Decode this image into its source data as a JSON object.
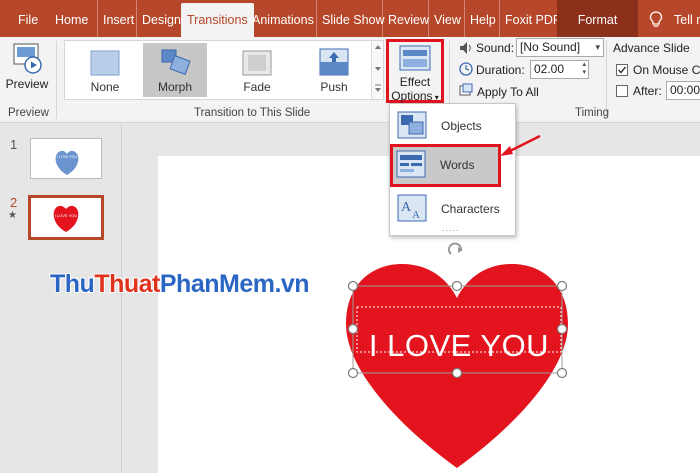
{
  "tabs": [
    {
      "label": "File"
    },
    {
      "label": "Home"
    },
    {
      "label": "Insert"
    },
    {
      "label": "Design"
    },
    {
      "label": "Transitions"
    },
    {
      "label": "Animations"
    },
    {
      "label": "Slide Show"
    },
    {
      "label": "Review"
    },
    {
      "label": "View"
    },
    {
      "label": "Help"
    },
    {
      "label": "Foxit PDF"
    },
    {
      "label": "Format"
    },
    {
      "label": "Tell m"
    }
  ],
  "ribbon": {
    "preview": {
      "label": "Preview",
      "group": "Preview"
    },
    "transitions": {
      "group": "Transition to This Slide",
      "items": [
        {
          "label": "None"
        },
        {
          "label": "Morph"
        },
        {
          "label": "Fade"
        },
        {
          "label": "Push"
        }
      ],
      "selected": "Morph"
    },
    "effect_options": {
      "line1": "Effect",
      "line2": "Options"
    },
    "timing": {
      "group": "Timing",
      "sound_label": "Sound:",
      "sound_value": "[No Sound]",
      "duration_label": "Duration:",
      "duration_value": "02.00",
      "apply_all": "Apply To All",
      "advance_title": "Advance Slide",
      "on_mouse_click": "On Mouse Cli",
      "after_label": "After:",
      "after_value": "00:00."
    }
  },
  "effect_menu": {
    "items": [
      {
        "label": "Objects"
      },
      {
        "label": "Words"
      },
      {
        "label": "Characters"
      }
    ],
    "selected": "Words"
  },
  "slides": [
    {
      "number": "1",
      "text": "I LOVE YOU"
    },
    {
      "number": "2",
      "text": "I LOVE YOU",
      "star": "★"
    }
  ],
  "slide_content": {
    "heart_text": "I LOVE YOU"
  },
  "watermark": {
    "part1": "Thu",
    "part2": "Thuat",
    "part3": "PhanMem.vn"
  },
  "colors": {
    "accent": "#b7472a",
    "highlight": "#e0141e",
    "heart": "#e3141d"
  }
}
